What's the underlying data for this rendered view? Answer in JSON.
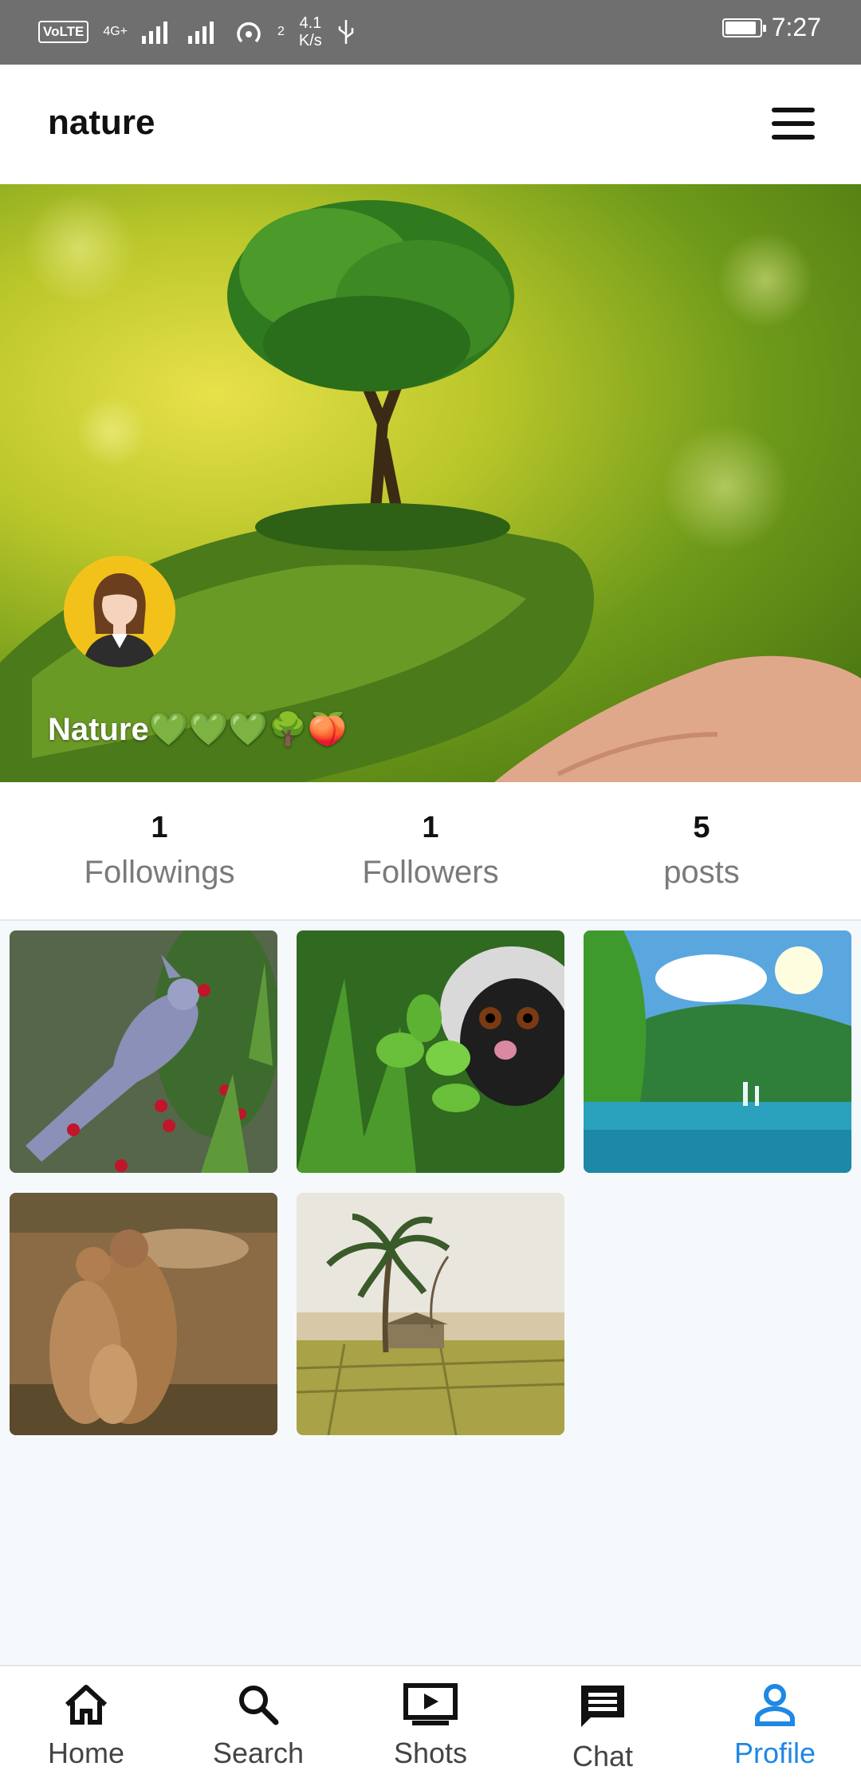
{
  "status_bar": {
    "volte": "VoLTE",
    "sim": "1",
    "network": "4G+",
    "signal2": "2",
    "speed_value": "4.1",
    "speed_unit": "K/s",
    "time": "7:27"
  },
  "header": {
    "title": "nature"
  },
  "profile": {
    "display_name": "Nature💚💚💚🌳🍑"
  },
  "stats": [
    {
      "value": "1",
      "label": "Followings"
    },
    {
      "value": "1",
      "label": "Followers"
    },
    {
      "value": "5",
      "label": "posts"
    }
  ],
  "posts": [
    {
      "subject": "bird-photo"
    },
    {
      "subject": "monkey-photo"
    },
    {
      "subject": "lake-photo"
    },
    {
      "subject": "prairie-dogs-photo"
    },
    {
      "subject": "palm-tree-field-photo"
    }
  ],
  "bottom_nav": {
    "items": [
      {
        "label": "Home",
        "icon": "home-icon"
      },
      {
        "label": "Search",
        "icon": "search-icon"
      },
      {
        "label": "Shots",
        "icon": "video-icon"
      },
      {
        "label": "Chat",
        "icon": "chat-icon"
      },
      {
        "label": "Profile",
        "icon": "profile-icon",
        "active": true
      }
    ],
    "active_color": "#1e88e5"
  }
}
